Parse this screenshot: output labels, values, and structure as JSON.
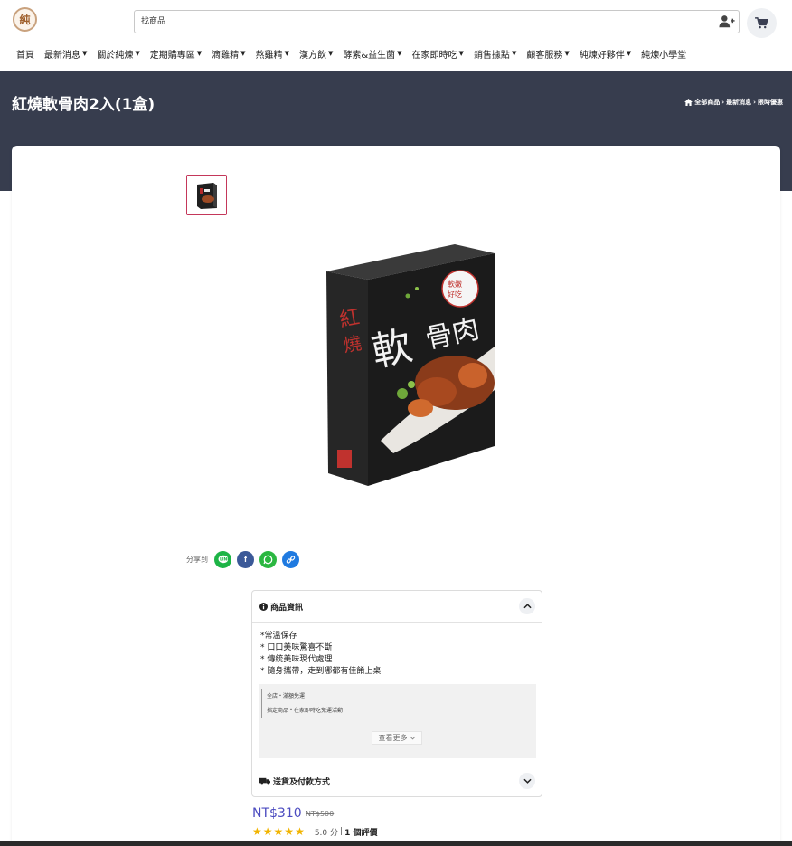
{
  "logo": {
    "glyph": "純"
  },
  "search": {
    "placeholder": "找商品"
  },
  "nav": [
    {
      "label": "首頁",
      "dropdown": false
    },
    {
      "label": "最新消息",
      "dropdown": true
    },
    {
      "label": "關於純煉",
      "dropdown": true
    },
    {
      "label": "定期購專區",
      "dropdown": true
    },
    {
      "label": "滴雞精",
      "dropdown": true
    },
    {
      "label": "熬雞精",
      "dropdown": true
    },
    {
      "label": "漢方飲",
      "dropdown": true
    },
    {
      "label": "酵素&益生菌",
      "dropdown": true
    },
    {
      "label": "在家即時吃",
      "dropdown": true
    },
    {
      "label": "銷售據點",
      "dropdown": true
    },
    {
      "label": "顧客服務",
      "dropdown": true
    },
    {
      "label": "純煉好夥伴",
      "dropdown": true
    },
    {
      "label": "純煉小學堂",
      "dropdown": false
    }
  ],
  "page": {
    "title": "紅燒軟骨肉2入(1盒)"
  },
  "breadcrumb": [
    "全部商品",
    "最新消息",
    "限時優惠"
  ],
  "share": {
    "label": "分享到"
  },
  "product_info": {
    "title": "商品資訊",
    "features": [
      "*常溫保存",
      "* 口口美味驚喜不斷",
      "* 傳統美味現代處理",
      "* 隨身攜帶，走到哪都有佳餚上桌"
    ],
    "promotions": [
      "全店・滿額免運",
      "指定商品・在家即時吃免運活動"
    ],
    "more_label": "查看更多"
  },
  "shipping": {
    "title": "送貨及付款方式"
  },
  "pricing": {
    "price": "NT$310",
    "original_price": "NT$500"
  },
  "rating": {
    "stars": 5,
    "score_text": "5.0 分",
    "separator": "|",
    "count_text": "1 個評價"
  },
  "colors": {
    "banner": "#373d4e",
    "price": "#4c4cc0",
    "star": "#f1b400",
    "thumb_border": "#c4375a"
  }
}
